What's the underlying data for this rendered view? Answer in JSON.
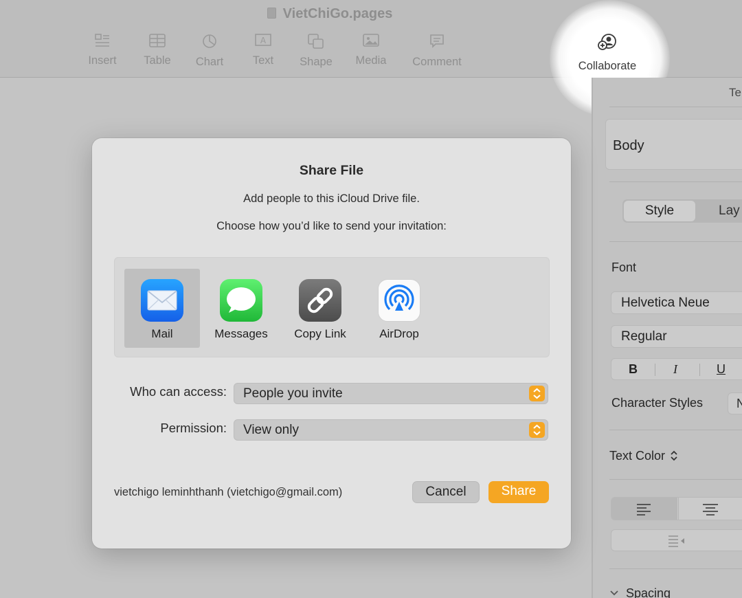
{
  "window": {
    "doc_title": "VietChiGo.pages"
  },
  "toolbar": {
    "items": [
      {
        "label": "Insert",
        "icon": "insert-icon"
      },
      {
        "label": "Table",
        "icon": "table-icon"
      },
      {
        "label": "Chart",
        "icon": "chart-icon"
      },
      {
        "label": "Text",
        "icon": "text-icon"
      },
      {
        "label": "Shape",
        "icon": "shape-icon"
      },
      {
        "label": "Media",
        "icon": "media-icon"
      },
      {
        "label": "Comment",
        "icon": "comment-icon"
      }
    ],
    "collaborate_label": "Collaborate"
  },
  "inspector": {
    "tab_partial": "Te",
    "paragraph_style": "Body",
    "segments": {
      "style": "Style",
      "layout_partial": "Lay"
    },
    "font_label": "Font",
    "font_family": "Helvetica Neue",
    "font_weight": "Regular",
    "bold": "B",
    "italic": "I",
    "underline": "U",
    "character_styles_label": "Character Styles",
    "character_styles_partial": "N",
    "text_color_label": "Text Color",
    "spacing_label": "Spacing"
  },
  "dialog": {
    "title": "Share File",
    "subtitle": "Add people to this iCloud Drive file.",
    "instruction": "Choose how you’d like to send your invitation:",
    "share_options": [
      {
        "label": "Mail",
        "icon": "mail-icon",
        "selected": true
      },
      {
        "label": "Messages",
        "icon": "messages-icon",
        "selected": false
      },
      {
        "label": "Copy Link",
        "icon": "link-icon",
        "selected": false
      },
      {
        "label": "AirDrop",
        "icon": "airdrop-icon",
        "selected": false
      }
    ],
    "access_label": "Who can access:",
    "access_value": "People you invite",
    "permission_label": "Permission:",
    "permission_value": "View only",
    "user": "vietchigo leminhthanh (vietchigo@gmail.com)",
    "cancel_label": "Cancel",
    "share_label": "Share"
  },
  "colors": {
    "accent": "#f5a623",
    "mail_blue": "#1e6ff0",
    "messages_green": "#34c759",
    "link_gray": "#5f5f5f",
    "airdrop_blue": "#1a7cf5"
  }
}
